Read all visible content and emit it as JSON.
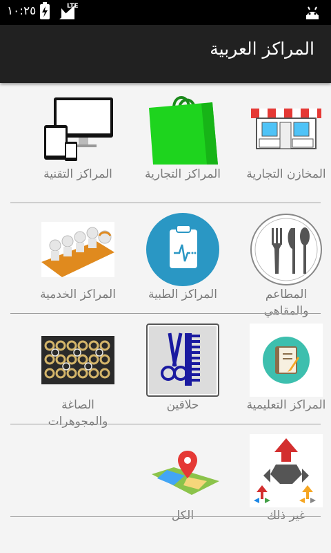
{
  "status_bar": {
    "time": "١٠:٢٥",
    "network": "LTE"
  },
  "app_bar": {
    "title": "المراكز العربية"
  },
  "rows": [
    {
      "items": [
        {
          "label": "المخازن التجارية",
          "icon": "shop-icon"
        },
        {
          "label": "المراكز التجارية",
          "icon": "shopping-bag-icon"
        },
        {
          "label": "المراكز التقنية",
          "icon": "devices-icon"
        }
      ]
    },
    {
      "items": [
        {
          "label": "المطاعم والمقاهي",
          "icon": "cutlery-icon"
        },
        {
          "label": "المراكز الطبية",
          "icon": "clipboard-medical-icon"
        },
        {
          "label": "المراكز الخدمية",
          "icon": "call-center-icon"
        }
      ]
    },
    {
      "items": [
        {
          "label": "المراكز التعليمية",
          "icon": "notebook-icon"
        },
        {
          "label": "حلاقين",
          "icon": "scissors-comb-icon"
        },
        {
          "label": "الصاغة والمجوهرات",
          "icon": "jewelry-rings-icon"
        }
      ]
    },
    {
      "items": [
        {
          "label": "غير ذلك",
          "icon": "arrows-icon"
        },
        {
          "label": "الكل",
          "icon": "map-pin-icon"
        }
      ]
    }
  ]
}
